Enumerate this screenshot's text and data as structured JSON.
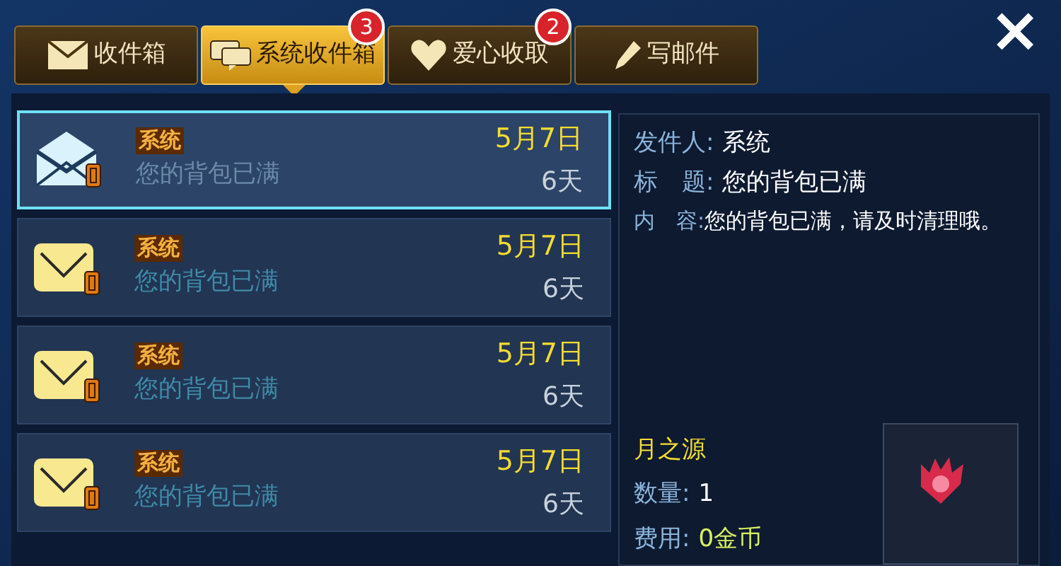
{
  "tabs": [
    {
      "label": "收件箱",
      "kind": "inbox",
      "selected": false
    },
    {
      "label": "系统收件箱",
      "kind": "system",
      "selected": true,
      "badge": "3"
    },
    {
      "label": "爱心收取",
      "kind": "hearts",
      "selected": false,
      "badge": "2"
    },
    {
      "label": "写邮件",
      "kind": "compose",
      "selected": false
    }
  ],
  "close_button": "×",
  "mails": [
    {
      "sender": "系统",
      "subject": "您的背包已满",
      "date": "5月7日",
      "expires": "6天",
      "read": true,
      "selected": true
    },
    {
      "sender": "系统",
      "subject": "您的背包已满",
      "date": "5月7日",
      "expires": "6天",
      "read": false,
      "selected": false
    },
    {
      "sender": "系统",
      "subject": "您的背包已满",
      "date": "5月7日",
      "expires": "6天",
      "read": false,
      "selected": false
    },
    {
      "sender": "系统",
      "subject": "您的背包已满",
      "date": "5月7日",
      "expires": "6天",
      "read": false,
      "selected": false
    }
  ],
  "detail": {
    "sender_label": "发件人:",
    "sender": "系统",
    "title_label": "标　题:",
    "title": "您的背包已满",
    "content_label": "内　容:",
    "content": "您的背包已满，请及时清理哦。",
    "item_name": "月之源",
    "quantity_label": "数量:",
    "quantity": "1",
    "cost_label": "费用:",
    "cost": "0金币"
  }
}
